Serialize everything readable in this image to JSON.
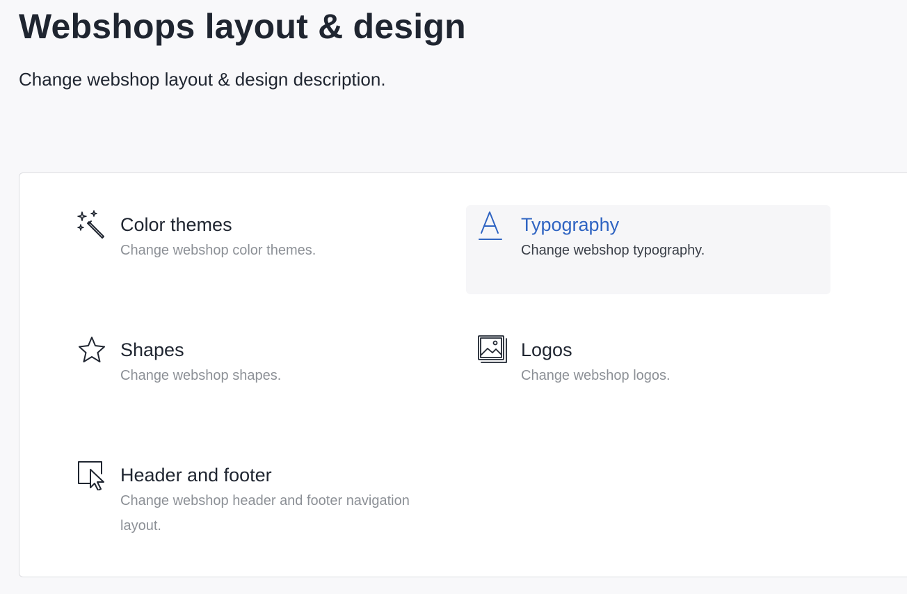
{
  "page": {
    "title": "Webshops layout & design",
    "description": "Change webshop layout & design description."
  },
  "options": [
    {
      "icon": "magic-wand-icon",
      "title": "Color themes",
      "description": "Change webshop color themes."
    },
    {
      "icon": "typography-letter-a-icon",
      "title": "Typography",
      "description": "Change webshop typography.",
      "highlighted": true
    },
    {
      "icon": "star-icon",
      "title": "Shapes",
      "description": "Change webshop shapes."
    },
    {
      "icon": "images-icon",
      "title": "Logos",
      "description": "Change webshop logos."
    },
    {
      "icon": "cursor-window-icon",
      "title": "Header and footer",
      "description": "Change webshop header and footer navigation layout."
    }
  ],
  "colors": {
    "background": "#f8f8fa",
    "card": "#ffffff",
    "text": "#1f2530",
    "muted": "#8c9096",
    "accent": "#2f64c2",
    "hover_background": "#f6f6f8"
  }
}
